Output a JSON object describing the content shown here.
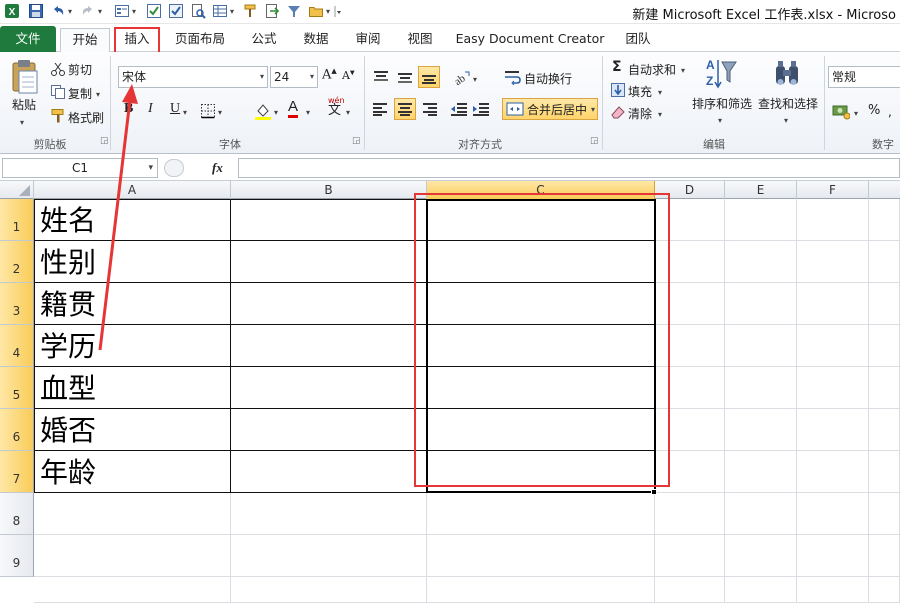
{
  "window": {
    "title": "新建 Microsoft Excel 工作表.xlsx  -  Microso"
  },
  "quick_access": [
    "excel-logo-icon",
    "save-icon",
    "undo-icon",
    "redo-icon",
    "form-icon",
    "check-icon",
    "check2-icon",
    "print-preview-icon",
    "table-icon",
    "format-painter-icon",
    "export-icon",
    "filter-icon",
    "open-folder-icon",
    "customize-icon"
  ],
  "tabs": [
    {
      "id": "file",
      "label": "文件"
    },
    {
      "id": "home",
      "label": "开始"
    },
    {
      "id": "insert",
      "label": "插入"
    },
    {
      "id": "page-layout",
      "label": "页面布局"
    },
    {
      "id": "formulas",
      "label": "公式"
    },
    {
      "id": "data",
      "label": "数据"
    },
    {
      "id": "review",
      "label": "审阅"
    },
    {
      "id": "view",
      "label": "视图"
    },
    {
      "id": "easy-doc",
      "label": "Easy Document Creator"
    },
    {
      "id": "team",
      "label": "团队"
    }
  ],
  "ribbon": {
    "clipboard": {
      "paste": "粘贴",
      "cut": "剪切",
      "copy": "复制",
      "format_painter": "格式刷",
      "group": "剪贴板"
    },
    "font": {
      "name": "宋体",
      "size": "24",
      "grow": "A",
      "shrink": "A",
      "bold": "B",
      "italic": "I",
      "underline": "U",
      "color": "A",
      "phonetic": "wén",
      "phonetic_char": "文",
      "group": "字体"
    },
    "alignment": {
      "wrap": "自动换行",
      "merge": "合并后居中",
      "group": "对齐方式"
    },
    "editing": {
      "autosum": "自动求和",
      "fill": "填充",
      "clear": "清除",
      "sort": "排序和筛选",
      "find": "查找和选择",
      "group": "编辑"
    },
    "number": {
      "format": "常规",
      "percent": "%",
      "group": "数字"
    }
  },
  "formula_bar": {
    "name_box": "C1",
    "fx": "fx",
    "content": ""
  },
  "grid": {
    "columns": [
      "A",
      "B",
      "C",
      "D",
      "E",
      "F"
    ],
    "selected_column": "C",
    "rows": [
      "1",
      "2",
      "3",
      "4",
      "5",
      "6",
      "7",
      "8",
      "9"
    ],
    "cells_A": [
      "姓名",
      "性别",
      "籍贯",
      "学历",
      "血型",
      "婚否",
      "年龄"
    ]
  },
  "annotation": {
    "color": "#e53535"
  }
}
